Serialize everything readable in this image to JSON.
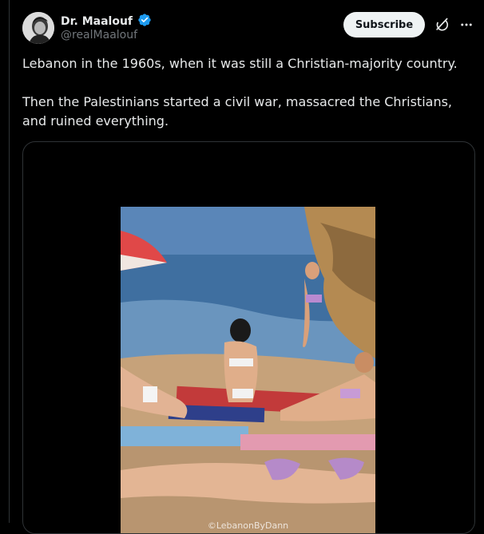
{
  "author": {
    "display_name": "Dr. Maalouf",
    "handle": "@realMaalouf",
    "verified": true,
    "verified_color": "#1d9bf0"
  },
  "actions": {
    "subscribe_label": "Subscribe",
    "grok_icon": "grok-icon",
    "more_icon": "more-icon"
  },
  "tweet": {
    "text": "Lebanon in the 1960s, when it was still a Christian-majority country.\n\nThen the Palestinians started a civil war, massacred the Christians, and ruined everything."
  },
  "media": {
    "watermark": "©LebanonByDann"
  }
}
